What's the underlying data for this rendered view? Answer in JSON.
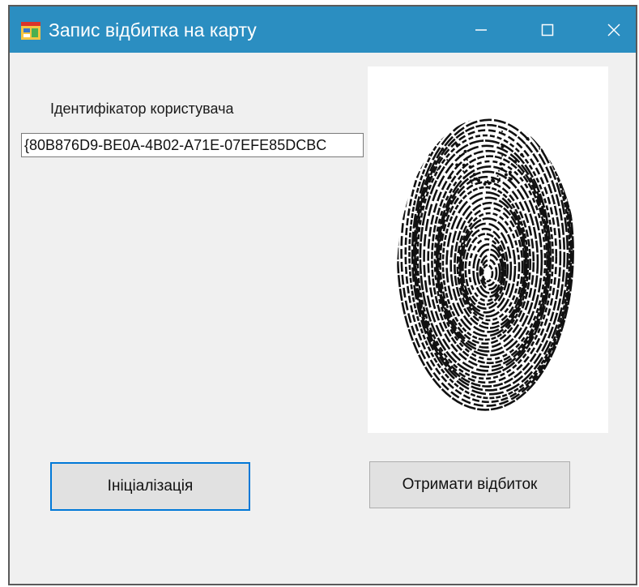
{
  "window": {
    "title": "Запис відбитка на карту",
    "icon": "app-form-icon",
    "controls": [
      "minimize-icon",
      "maximize-icon",
      "close-icon"
    ]
  },
  "form": {
    "user_id_label": "Ідентифікатор користувача",
    "user_id_value": "{80B876D9-BE0A-4B02-A71E-07EFE85DCBC"
  },
  "fingerprint_image": {
    "icon": "fingerprint-image"
  },
  "buttons": {
    "init_label": "Ініціалізація",
    "get_fingerprint_label": "Отримати відбиток"
  },
  "colors": {
    "titlebar": "#2b8ec1",
    "window_bg": "#f0f0f0",
    "focus_border": "#0078d7"
  }
}
